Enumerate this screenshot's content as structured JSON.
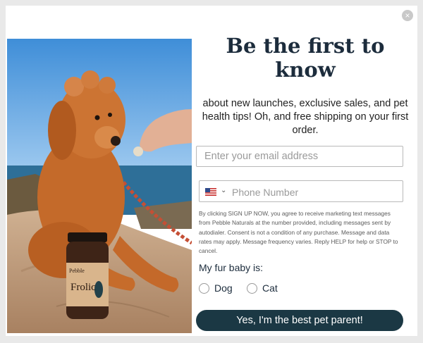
{
  "popup": {
    "close_label": "×",
    "headline": "Be the first to know",
    "subtext": "about new launches, exclusive sales, and pet health tips! Oh, and free shipping on your first order.",
    "email_placeholder": "Enter your email address",
    "phone": {
      "country_flag": "us-flag-icon",
      "chevron": "⌄",
      "placeholder": "Phone Number"
    },
    "disclaimer": "By clicking SIGN UP NOW, you agree to receive marketing text messages from Pebble Naturals at the number provided, including messages sent by autodialer. Consent is not a condition of any purchase. Message and data rates may apply. Message frequency varies. Reply HELP for help or STOP to cancel.",
    "fur_label": "My fur baby is:",
    "options": [
      {
        "label": "Dog",
        "selected": false
      },
      {
        "label": "Cat",
        "selected": false
      }
    ],
    "cta_label": "Yes, I'm the best pet parent!"
  },
  "photo": {
    "bottle_brand": "Pebble",
    "bottle_product": "Frolic"
  },
  "colors": {
    "headline": "#1c2c3c",
    "cta_background": "#1b3844",
    "sky": "#56a2e2",
    "sea": "#2f6f98",
    "rock": "#c29f80",
    "dog": "#c9702d"
  }
}
